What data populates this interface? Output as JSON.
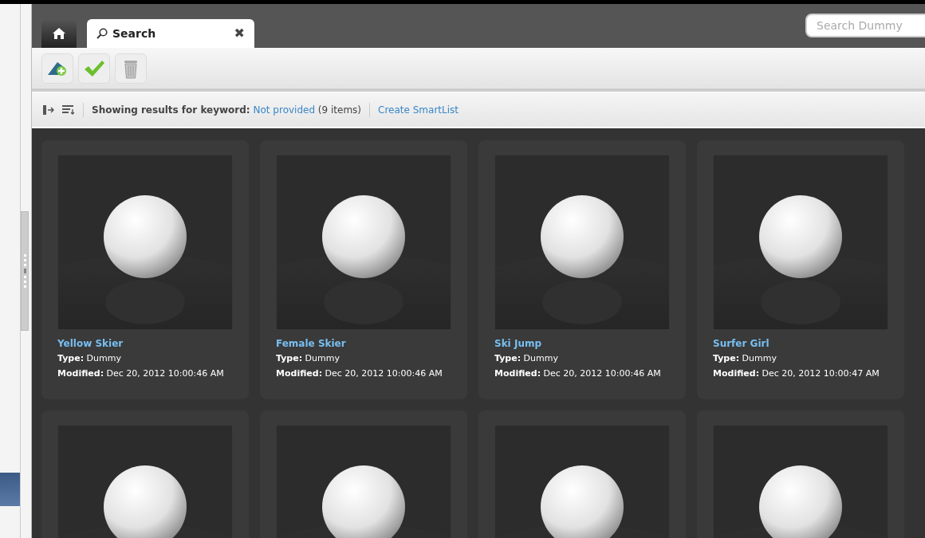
{
  "tabs": [
    {
      "kind": "home",
      "selected": false
    },
    {
      "kind": "search",
      "label": "Search",
      "close": "✖",
      "selected": true
    }
  ],
  "search": {
    "placeholder": "Search Dummy"
  },
  "toolbar": [
    {
      "kind": "add"
    },
    {
      "kind": "approve"
    },
    {
      "kind": "delete"
    }
  ],
  "filter_bar": {
    "label": "Showing results for keyword:",
    "keyword": "Not provided",
    "count": "(9 items)",
    "action": "Create SmartList"
  },
  "results": [
    {
      "kind": "full",
      "name": "Yellow Skier",
      "type_label": "Type:",
      "type": "Dummy",
      "modified_label": "Modified:",
      "modified": "Dec 20, 2012 10:00:46 AM"
    },
    {
      "kind": "full",
      "name": "Female Skier",
      "type_label": "Type:",
      "type": "Dummy",
      "modified_label": "Modified:",
      "modified": "Dec 20, 2012 10:00:46 AM"
    },
    {
      "kind": "full",
      "name": "Ski Jump",
      "type_label": "Type:",
      "type": "Dummy",
      "modified_label": "Modified:",
      "modified": "Dec 20, 2012 10:00:46 AM"
    },
    {
      "kind": "full",
      "name": "Surfer Girl",
      "type_label": "Type:",
      "type": "Dummy",
      "modified_label": "Modified:",
      "modified": "Dec 20, 2012 10:00:47 AM"
    },
    {
      "kind": "thumbnail_only"
    },
    {
      "kind": "thumbnail_only"
    },
    {
      "kind": "thumbnail_only"
    },
    {
      "kind": "thumbnail_only"
    }
  ]
}
